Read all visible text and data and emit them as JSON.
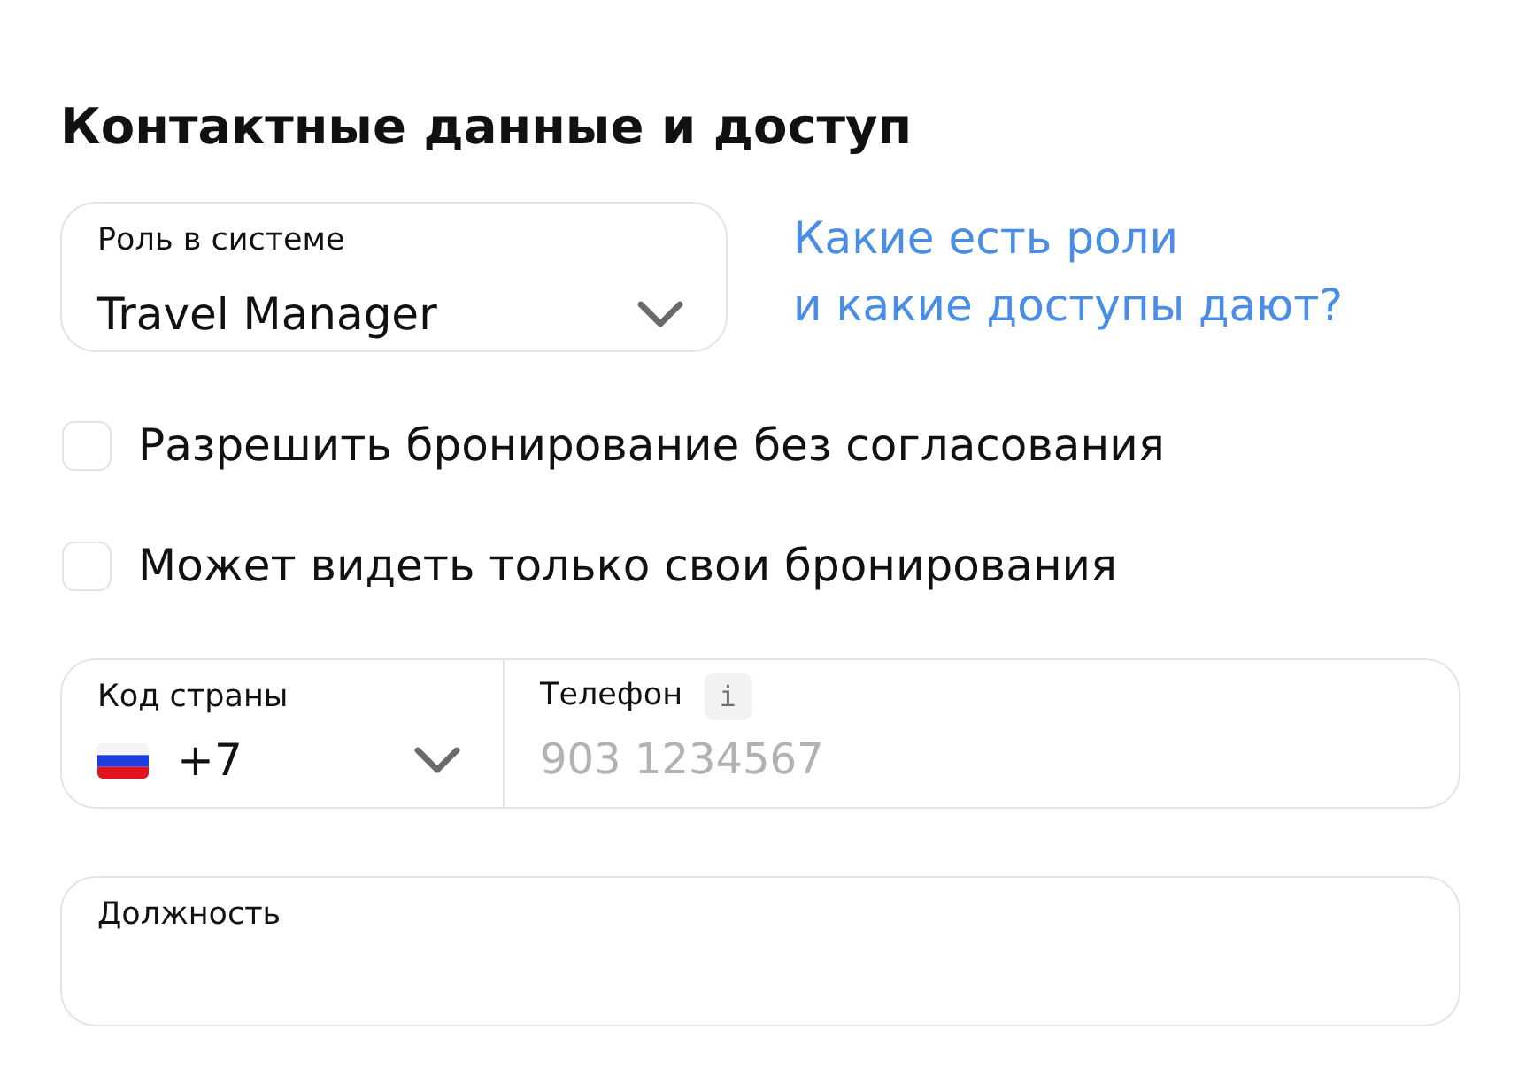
{
  "section": {
    "title": "Контактные данные и доступ"
  },
  "role_select": {
    "label": "Роль в системе",
    "value": "Travel Manager"
  },
  "help_link": {
    "lines": [
      "Какие есть роли",
      "и какие доступы дают?"
    ]
  },
  "checkboxes": [
    {
      "label": "Разрешить бронирование без согласования",
      "checked": false
    },
    {
      "label": "Может видеть только свои бронирования",
      "checked": false
    }
  ],
  "phone": {
    "country_code": {
      "label": "Код страны",
      "value": "+7"
    },
    "number": {
      "label": "Телефон",
      "info_badge": "i",
      "placeholder": "903 1234567"
    }
  },
  "position": {
    "label": "Должность"
  }
}
